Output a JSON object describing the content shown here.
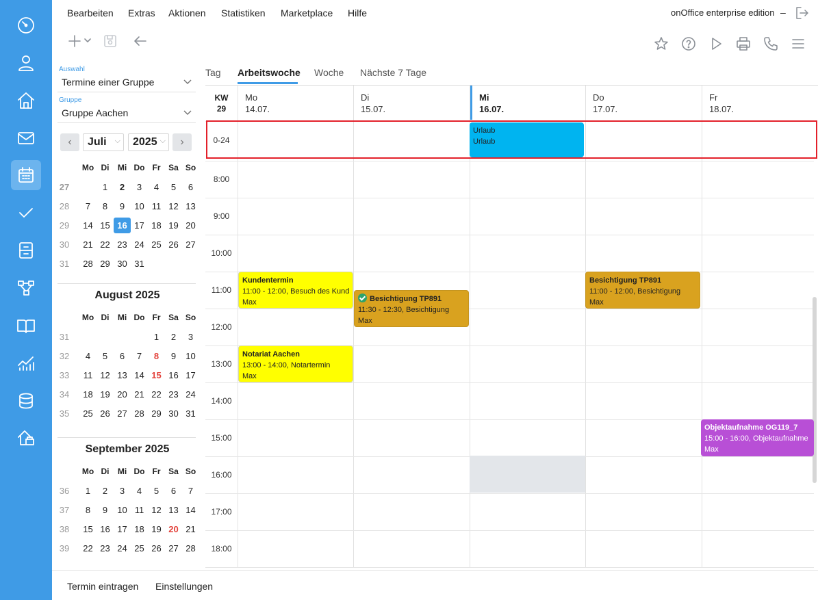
{
  "menu": {
    "items": [
      "Bearbeiten",
      "Extras",
      "Aktionen",
      "Statistiken",
      "Marketplace",
      "Hilfe"
    ],
    "edition": "onOffice enterprise edition",
    "edition_dash": "–"
  },
  "rail_icons": [
    "dashboard-icon",
    "user-icon",
    "home-icon",
    "mail-icon",
    "calendar-icon",
    "check-icon",
    "cabinet-icon",
    "process-icon",
    "book-icon",
    "statistics-icon",
    "database-icon",
    "property-icon"
  ],
  "filters": {
    "selection_label": "Auswahl",
    "selection_value": "Termine einer Gruppe",
    "group_label": "Gruppe",
    "group_value": "Gruppe Aachen"
  },
  "month_nav": {
    "month": "Juli",
    "year": "2025",
    "prev": "‹",
    "next": "›"
  },
  "weekday_heads": [
    "Mo",
    "Di",
    "Mi",
    "Do",
    "Fr",
    "Sa",
    "So"
  ],
  "mini_cals": [
    {
      "title": "",
      "weeks": [
        {
          "wk": "27",
          "days": [
            "",
            "1",
            "2",
            "3",
            "4",
            "5",
            "6"
          ]
        },
        {
          "wk": "28",
          "days": [
            "7",
            "8",
            "9",
            "10",
            "11",
            "12",
            "13"
          ]
        },
        {
          "wk": "29",
          "days": [
            "14",
            "15",
            "16",
            "17",
            "18",
            "19",
            "20"
          ]
        },
        {
          "wk": "30",
          "days": [
            "21",
            "22",
            "23",
            "24",
            "25",
            "26",
            "27"
          ]
        },
        {
          "wk": "31",
          "days": [
            "28",
            "29",
            "30",
            "31",
            "",
            "",
            ""
          ]
        }
      ]
    },
    {
      "title": "August 2025",
      "weeks": [
        {
          "wk": "31",
          "days": [
            "",
            "",
            "",
            "",
            "1",
            "2",
            "3"
          ]
        },
        {
          "wk": "32",
          "days": [
            "4",
            "5",
            "6",
            "7",
            "8",
            "9",
            "10"
          ]
        },
        {
          "wk": "33",
          "days": [
            "11",
            "12",
            "13",
            "14",
            "15",
            "16",
            "17"
          ]
        },
        {
          "wk": "34",
          "days": [
            "18",
            "19",
            "20",
            "21",
            "22",
            "23",
            "24"
          ]
        },
        {
          "wk": "35",
          "days": [
            "25",
            "26",
            "27",
            "28",
            "29",
            "30",
            "31"
          ]
        }
      ]
    },
    {
      "title": "September 2025",
      "weeks": [
        {
          "wk": "36",
          "days": [
            "1",
            "2",
            "3",
            "4",
            "5",
            "6",
            "7"
          ]
        },
        {
          "wk": "37",
          "days": [
            "8",
            "9",
            "10",
            "11",
            "12",
            "13",
            "14"
          ]
        },
        {
          "wk": "38",
          "days": [
            "15",
            "16",
            "17",
            "18",
            "19",
            "20",
            "21"
          ]
        },
        {
          "wk": "39",
          "days": [
            "22",
            "23",
            "24",
            "25",
            "26",
            "27",
            "28"
          ]
        }
      ]
    }
  ],
  "view_tabs": [
    "Tag",
    "Arbeitswoche",
    "Woche",
    "Nächste 7 Tage"
  ],
  "active_view": "Arbeitswoche",
  "week": {
    "kw_label": "KW",
    "kw_number": "29",
    "days": [
      {
        "name": "Mo",
        "date": "14.07."
      },
      {
        "name": "Di",
        "date": "15.07."
      },
      {
        "name": "Mi",
        "date": "16.07."
      },
      {
        "name": "Do",
        "date": "17.07."
      },
      {
        "name": "Fr",
        "date": "18.07."
      }
    ],
    "allday_label": "0-24",
    "hours": [
      "8:00",
      "9:00",
      "10:00",
      "11:00",
      "12:00",
      "13:00",
      "14:00",
      "15:00",
      "16:00",
      "17:00",
      "18:00"
    ]
  },
  "events": {
    "urlaub": {
      "title": "Urlaub",
      "line2": "Urlaub"
    },
    "kundentermin": {
      "title": "Kundentermin",
      "line2": "11:00 - 12:00, Besuch des Kund",
      "line3": "Max"
    },
    "besichtigung_di": {
      "title": "Besichtigung TP891",
      "line2": "11:30 - 12:30, Besichtigung",
      "line3": "Max"
    },
    "besichtigung_do": {
      "title": "Besichtigung TP891",
      "line2": "11:00 - 12:00, Besichtigung",
      "line3": "Max"
    },
    "notariat": {
      "title": "Notariat Aachen",
      "line2": "13:00 - 14:00, Notartermin",
      "line3": "Max"
    },
    "objektaufnahme": {
      "title": "Objektaufnahme OG119_7",
      "line2": "15:00 - 16:00, Objektaufnahme",
      "line3": "Max"
    }
  },
  "footer": {
    "add": "Termin eintragen",
    "settings": "Einstellungen"
  },
  "colors": {
    "accent": "#3f9be6",
    "today_badge": "#3f9be6",
    "holiday_red": "#e3423b",
    "highlight_frame": "#e3202a",
    "event_yellow": "#ffff00",
    "event_gold": "#d9a21f",
    "event_purple": "#b84fd6",
    "event_cyan": "#00b4f0"
  }
}
